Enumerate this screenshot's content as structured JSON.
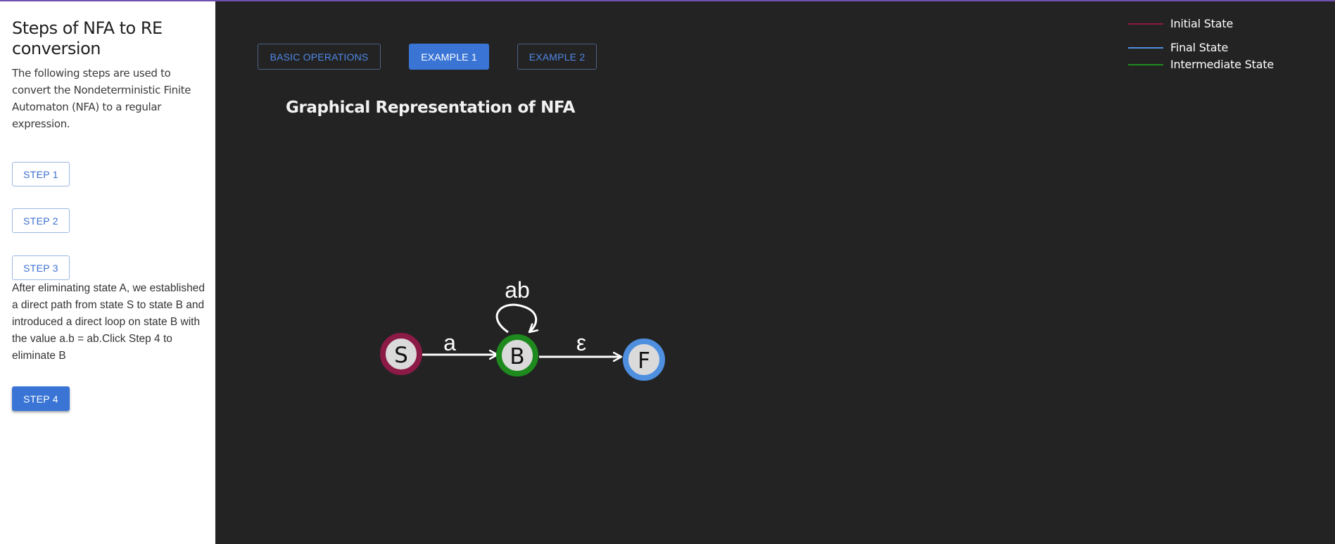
{
  "sidebar": {
    "title": "Steps of NFA to RE conversion",
    "intro": "The following steps are used to convert the Nondeterministic Finite Automaton (NFA) to a regular expression.",
    "steps": [
      {
        "label": "STEP 1"
      },
      {
        "label": "STEP 2"
      },
      {
        "label": "STEP 3"
      },
      {
        "label": "STEP 4"
      }
    ],
    "step_description": "After eliminating state A, we established a direct path from state S to state B and introduced a direct loop on state B with the value a.b = ab.Click Step 4 to eliminate B"
  },
  "tabs": [
    {
      "label": "BASIC OPERATIONS",
      "active": false
    },
    {
      "label": "EXAMPLE 1",
      "active": true
    },
    {
      "label": "EXAMPLE 2",
      "active": false
    }
  ],
  "graph": {
    "title": "Graphical Representation of NFA",
    "states": [
      {
        "name": "S",
        "role": "initial"
      },
      {
        "name": "B",
        "role": "intermediate"
      },
      {
        "name": "F",
        "role": "final"
      }
    ],
    "transitions": [
      {
        "from": "S",
        "to": "B",
        "label": "a"
      },
      {
        "from": "B",
        "to": "B",
        "label": "ab"
      },
      {
        "from": "B",
        "to": "F",
        "label": "ε"
      }
    ]
  },
  "legend": [
    {
      "label": "Initial State",
      "color": "#8b1a46"
    },
    {
      "label": "Final State",
      "color": "#4f8fe0"
    },
    {
      "label": "Intermediate State",
      "color": "#1e8a1e"
    }
  ],
  "colors": {
    "initial": "#8b1a46",
    "final": "#4f8fe0",
    "intermediate": "#1e8a1e",
    "accent": "#3a75d6",
    "background": "#232323"
  }
}
